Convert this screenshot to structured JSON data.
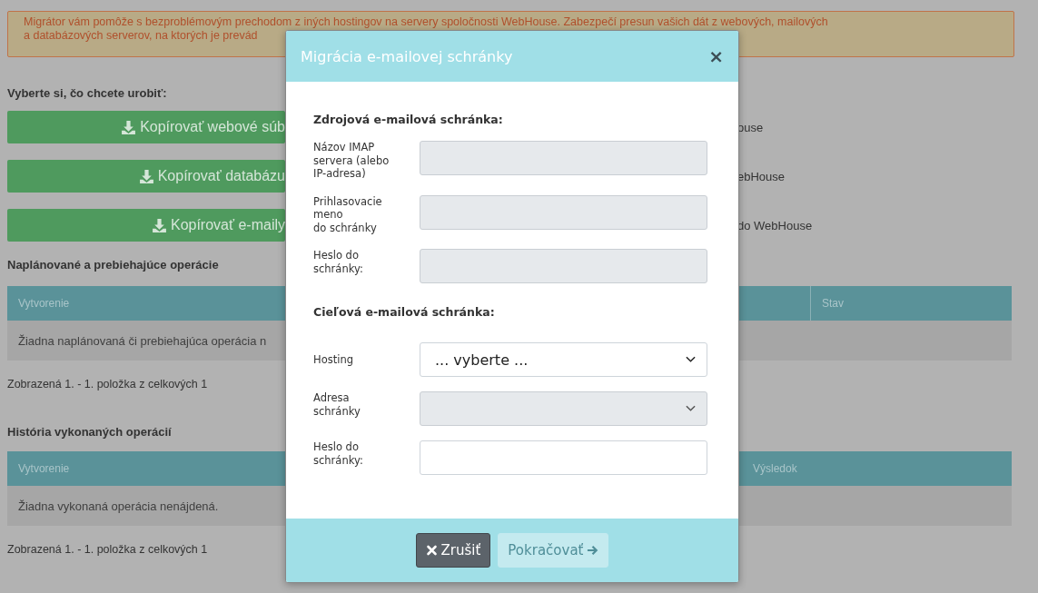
{
  "alert": {
    "text": "Migrátor vám pomôže s bezproblémovým prechodom z iných hostingov na servery spoločnosti WebHouse. Zabezpečí presun vašich dát z webových, mailových\na databázových serverov, na ktorých je prevád"
  },
  "prompt": "Vyberte si, čo chcete urobiť:",
  "actions": [
    {
      "label": "Kopírovať webové súb",
      "description": "ouse"
    },
    {
      "label": "Kopírovať databázu",
      "description": "ebHouse"
    },
    {
      "label": "Kopírovať e-maily",
      "description": "do WebHouse"
    }
  ],
  "sections": [
    {
      "title": "Naplánované a prebiehajúce operácie",
      "columns": [
        "Vytvorenie",
        "Stav"
      ],
      "empty": "Žiadna naplánovaná či prebiehajúca operácia n",
      "pager": "Zobrazená 1. - 1. položka z celkových 1"
    },
    {
      "title": "História vykonaných operácií",
      "columns": [
        "Vytvorenie",
        "Výsledok"
      ],
      "empty": "Žiadna vykonaná operácia nenájdená.",
      "pager": "Zobrazená 1. - 1. položka z celkových 1"
    }
  ],
  "modal": {
    "title": "Migrácia e-mailovej schránky",
    "close": "×",
    "groups": [
      {
        "heading": "Zdrojová e-mailová schránka:",
        "fields": [
          {
            "label": "Názov IMAP servera (alebo IP-adresa)",
            "kind": "input",
            "disabled": true
          },
          {
            "label": "Prihlasovacie meno\ndo schránky",
            "kind": "input",
            "disabled": true
          },
          {
            "label": "Heslo do schránky:",
            "kind": "input",
            "disabled": true
          }
        ]
      },
      {
        "heading": "Cieľová e-mailová schránka:",
        "fields": [
          {
            "label": "Hosting",
            "kind": "select",
            "value": "... vyberte ...",
            "disabled": false
          },
          {
            "label": "Adresa schránky",
            "kind": "select",
            "disabled": true
          },
          {
            "label": "Heslo do schránky:",
            "kind": "input",
            "disabled": false
          }
        ]
      }
    ],
    "buttons": [
      {
        "label": "Zrušiť",
        "kind": "cancel",
        "disabled": false
      },
      {
        "label": "Pokračovať",
        "kind": "next",
        "disabled": true
      }
    ]
  }
}
